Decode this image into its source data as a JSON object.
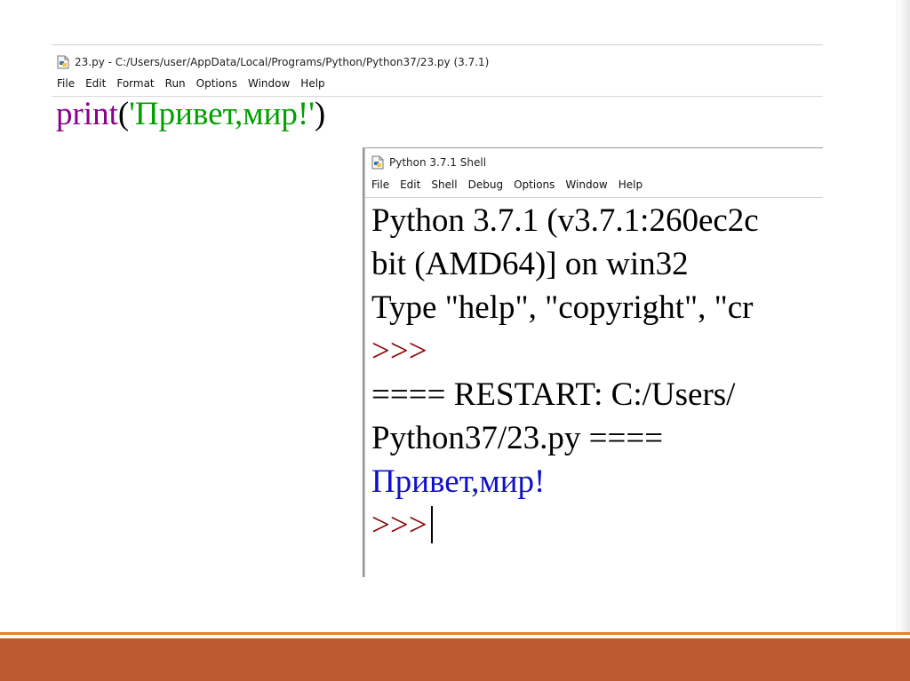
{
  "editor": {
    "title": "23.py - C:/Users/user/AppData/Local/Programs/Python/Python37/23.py (3.7.1)",
    "menu": [
      "File",
      "Edit",
      "Format",
      "Run",
      "Options",
      "Window",
      "Help"
    ],
    "code": {
      "keyword": "print",
      "open_paren": "(",
      "string": "'Привет,мир!'",
      "close_paren": ")"
    }
  },
  "shell": {
    "title": "Python 3.7.1 Shell",
    "menu": [
      "File",
      "Edit",
      "Shell",
      "Debug",
      "Options",
      "Window",
      "Help"
    ],
    "lines": [
      "Python 3.7.1 (v3.7.1:260ec2c",
      "bit (AMD64)] on win32",
      "Type \"help\", \"copyright\", \"cr",
      ">>>",
      "==== RESTART: C:/Users/",
      "Python37/23.py ====",
      "Привет,мир!",
      ">>>"
    ]
  },
  "colors": {
    "keyword": "#8b008b",
    "string": "#00a000",
    "prompt": "#8b0000",
    "output": "#1010cc",
    "bar": "#bb5a2e",
    "bar_line": "#e0822d"
  },
  "icons": {
    "editor": "python-file-icon",
    "shell": "python-shell-icon"
  }
}
